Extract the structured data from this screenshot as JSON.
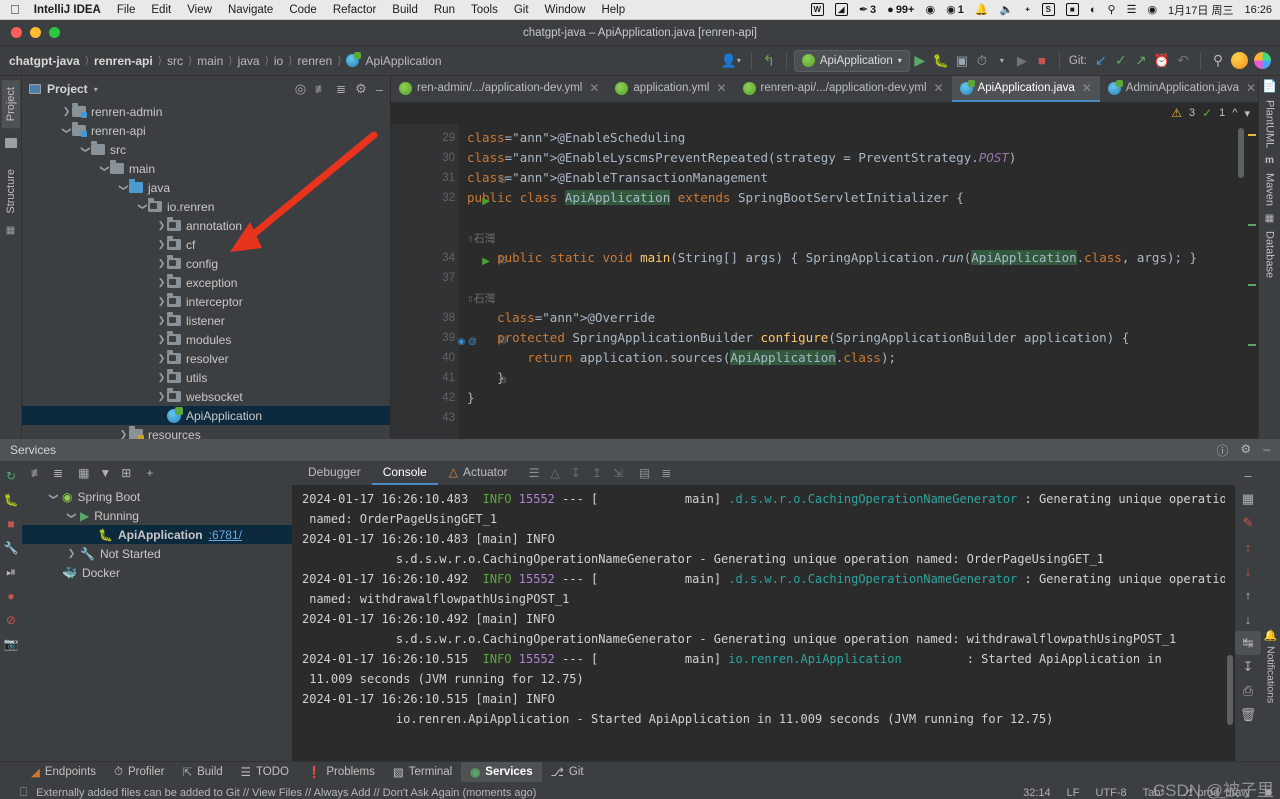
{
  "macbar": {
    "apple_icon": "apple-icon",
    "app_name": "IntelliJ IDEA",
    "menus": [
      "File",
      "Edit",
      "View",
      "Navigate",
      "Code",
      "Refactor",
      "Build",
      "Run",
      "Tools",
      "Git",
      "Window",
      "Help"
    ],
    "status_items": [
      {
        "icon": "wps-icon",
        "glyph": "W",
        "label": ""
      },
      {
        "icon": "notes-icon",
        "glyph": "◩",
        "label": ""
      },
      {
        "icon": "thunderbird-icon",
        "glyph": "✐",
        "label": "3"
      },
      {
        "icon": "bell-filled-icon",
        "glyph": "⬤",
        "label": "99+"
      },
      {
        "icon": "wechat-icon",
        "glyph": "◉",
        "label": ""
      },
      {
        "icon": "wechat-work-icon",
        "glyph": "◉",
        "label": "1"
      },
      {
        "icon": "notification-bell-icon",
        "glyph": "⬤",
        "label": ""
      },
      {
        "icon": "volume-icon",
        "glyph": "◂",
        "label": ""
      },
      {
        "icon": "bluetooth-icon",
        "glyph": "Ƀ",
        "label": ""
      },
      {
        "icon": "snipaste-icon",
        "glyph": "S",
        "label": ""
      },
      {
        "icon": "battery-icon",
        "glyph": "▮",
        "label": ""
      },
      {
        "icon": "wifi-icon",
        "glyph": "◠",
        "label": ""
      },
      {
        "icon": "spotlight-search-icon",
        "glyph": "⚲",
        "label": ""
      },
      {
        "icon": "control-center-icon",
        "glyph": "⌸",
        "label": ""
      },
      {
        "icon": "siri-icon",
        "glyph": "●",
        "label": ""
      }
    ],
    "date": "1月17日 周三",
    "time": "16:26"
  },
  "window": {
    "title": "chatgpt-java – ApiApplication.java [renren-api]"
  },
  "navbar": {
    "breadcrumbs": [
      "chatgpt-java",
      "renren-api",
      "src",
      "main",
      "java",
      "io",
      "renren",
      "ApiApplication"
    ],
    "run_config": "ApiApplication",
    "git_label": "Git:",
    "icons": [
      "vcs-person-icon",
      "back-arrow-icon",
      "run-icon",
      "debug-icon",
      "run-with-coverage-icon",
      "profiler-icon",
      "rerun-icon",
      "stop-icon",
      "update-project-icon",
      "commit-icon",
      "push-icon",
      "history-icon",
      "rollback-icon",
      "search-everywhere-icon",
      "account-avatar-icon",
      "ai-assistant-icon"
    ]
  },
  "left_strip": {
    "tabs": [
      {
        "label": "Project",
        "icon": "project-icon",
        "selected": true
      },
      {
        "label": "Structure",
        "icon": "structure-icon",
        "selected": false
      }
    ]
  },
  "right_strip": {
    "tabs": [
      {
        "label": "PlantUML",
        "icon": "plantuml-icon"
      },
      {
        "label": "Maven",
        "icon": "maven-icon"
      },
      {
        "label": "Database",
        "icon": "database-icon"
      }
    ]
  },
  "project_panel": {
    "title": "Project",
    "dropdown_icon": "chevron-down-icon",
    "toolbar_icons": [
      "select-opened-file-icon",
      "expand-all-icon",
      "collapse-all-icon",
      "settings-gear-icon",
      "hide-icon"
    ],
    "tree": [
      {
        "label": "renren-admin",
        "depth": 1,
        "arrow": "collapsed",
        "icon": "module-folder",
        "selected": false
      },
      {
        "label": "renren-api",
        "depth": 1,
        "arrow": "expanded",
        "icon": "module-folder",
        "selected": false
      },
      {
        "label": "src",
        "depth": 2,
        "arrow": "expanded",
        "icon": "folder-gray",
        "selected": false
      },
      {
        "label": "main",
        "depth": 3,
        "arrow": "expanded",
        "icon": "folder-gray",
        "selected": false
      },
      {
        "label": "java",
        "depth": 4,
        "arrow": "expanded",
        "icon": "folder-blue",
        "selected": false
      },
      {
        "label": "io.renren",
        "depth": 5,
        "arrow": "expanded",
        "icon": "package",
        "selected": false
      },
      {
        "label": "annotation",
        "depth": 6,
        "arrow": "collapsed",
        "icon": "package",
        "selected": false
      },
      {
        "label": "cf",
        "depth": 6,
        "arrow": "collapsed",
        "icon": "package",
        "selected": false
      },
      {
        "label": "config",
        "depth": 6,
        "arrow": "collapsed",
        "icon": "package",
        "selected": false
      },
      {
        "label": "exception",
        "depth": 6,
        "arrow": "collapsed",
        "icon": "package",
        "selected": false
      },
      {
        "label": "interceptor",
        "depth": 6,
        "arrow": "collapsed",
        "icon": "package",
        "selected": false
      },
      {
        "label": "listener",
        "depth": 6,
        "arrow": "collapsed",
        "icon": "package",
        "selected": false
      },
      {
        "label": "modules",
        "depth": 6,
        "arrow": "collapsed",
        "icon": "package",
        "selected": false
      },
      {
        "label": "resolver",
        "depth": 6,
        "arrow": "collapsed",
        "icon": "package",
        "selected": false
      },
      {
        "label": "utils",
        "depth": 6,
        "arrow": "collapsed",
        "icon": "package",
        "selected": false
      },
      {
        "label": "websocket",
        "depth": 6,
        "arrow": "collapsed",
        "icon": "package",
        "selected": false
      },
      {
        "label": "ApiApplication",
        "depth": 6,
        "arrow": "none",
        "icon": "spring-class",
        "selected": true
      },
      {
        "label": "resources",
        "depth": 4,
        "arrow": "collapsed",
        "icon": "resources-folder",
        "selected": false
      }
    ]
  },
  "editor": {
    "tabs": [
      {
        "label": "ren-admin/.../application-dev.yml",
        "icon": "spring-yaml-icon",
        "active": false,
        "closable": true
      },
      {
        "label": "application.yml",
        "icon": "spring-yaml-icon",
        "active": false,
        "closable": true
      },
      {
        "label": "renren-api/.../application-dev.yml",
        "icon": "spring-yaml-icon",
        "active": false,
        "closable": true
      },
      {
        "label": "ApiApplication.java",
        "icon": "spring-class-icon",
        "active": true,
        "closable": true
      },
      {
        "label": "AdminApplication.java",
        "icon": "spring-class-icon",
        "active": false,
        "closable": true
      }
    ],
    "tab_overflow_icons": [
      "chevron-down-icon",
      "more-vertical-icon"
    ],
    "inspection": {
      "warning_count": "3",
      "weak_warning_count": "1",
      "prev_icon": "chevron-up-icon",
      "next_icon": "chevron-down-icon"
    },
    "author_tag": "石灿",
    "lines": [
      {
        "num": "29",
        "code": "@EnableScheduling"
      },
      {
        "num": "30",
        "code": "@EnableLyscmsPreventRepeated(strategy = PreventStrategy.POST)"
      },
      {
        "num": "31",
        "code": "@EnableTransactionManagement"
      },
      {
        "num": "32",
        "code": "public class ApiApplication extends SpringBootServletInitializer {"
      },
      {
        "num": "",
        "code": ""
      },
      {
        "num": "",
        "code": "石灿"
      },
      {
        "num": "34",
        "code": "    public static void main(String[] args) { SpringApplication.run(ApiApplication.class, args); }"
      },
      {
        "num": "37",
        "code": ""
      },
      {
        "num": "",
        "code": "石灿"
      },
      {
        "num": "38",
        "code": "    @Override"
      },
      {
        "num": "39",
        "code": "    protected SpringApplicationBuilder configure(SpringApplicationBuilder application) {"
      },
      {
        "num": "40",
        "code": "        return application.sources(ApiApplication.class);"
      },
      {
        "num": "41",
        "code": "    }"
      },
      {
        "num": "42",
        "code": "}"
      },
      {
        "num": "43",
        "code": ""
      }
    ]
  },
  "services": {
    "title": "Services",
    "head_icons": [
      "help-icon",
      "settings-gear-icon",
      "hide-icon"
    ],
    "left_icons": [
      "rerun-icon",
      "debug-icon",
      "stop-icon",
      "settings-wrench-icon",
      "resume-icon",
      "mute-breakpoints-icon",
      "disable-breakpoints-icon",
      "camera-icon"
    ],
    "toolbar_icons": [
      "expand-all-icon",
      "collapse-all-icon",
      "group-icon",
      "filter-icon",
      "add-tab-icon",
      "add-service-icon"
    ],
    "tree": [
      {
        "label": "Spring Boot",
        "depth": 1,
        "arrow": "expanded",
        "icon": "spring-boot-icon",
        "selected": false,
        "link": ""
      },
      {
        "label": "Running",
        "depth": 2,
        "arrow": "expanded",
        "icon": "run-green-icon",
        "selected": false,
        "link": ""
      },
      {
        "label": "ApiApplication",
        "depth": 3,
        "arrow": "none",
        "icon": "debug-bug-icon",
        "selected": true,
        "link": ":6781/"
      },
      {
        "label": "Not Started",
        "depth": 2,
        "arrow": "collapsed",
        "icon": "wrench-icon",
        "selected": false,
        "link": ""
      },
      {
        "label": "Docker",
        "depth": 1,
        "arrow": "none",
        "icon": "docker-icon",
        "selected": false,
        "link": ""
      }
    ],
    "console_tabs": [
      {
        "label": "Debugger",
        "icon": "",
        "active": false
      },
      {
        "label": "Console",
        "icon": "",
        "active": true
      },
      {
        "label": "Actuator",
        "icon": "actuator-icon",
        "active": false
      }
    ],
    "console_tool_icons": [
      "soft-wrap-icon",
      "scroll-up-icon",
      "scroll-to-end-icon",
      "scroll-to-top-icon",
      "scroll-end-icon",
      "print-icon",
      "clear-icon"
    ],
    "right_icons": [
      "hide-icon",
      "layout-icon",
      "edit-red-icon",
      "up-red-icon",
      "down-red-icon",
      "up-icon",
      "down-icon",
      "soft-wrap-icon",
      "scroll-to-end-icon",
      "print-icon",
      "trash-icon"
    ],
    "notifications_label": "Notifications",
    "console_log": [
      {
        "ts": "2024-01-17 16:26:10.483",
        "level": "INFO",
        "pid": "15552",
        "thread": "main]",
        "cls": ".d.s.w.r.o.CachingOperationNameGenerator",
        "msg": ": Generating unique operation"
      },
      {
        "plain": " named: OrderPageUsingGET_1"
      },
      {
        "plain": "2024-01-17 16:26:10.483 [main] INFO"
      },
      {
        "plain": "             s.d.s.w.r.o.CachingOperationNameGenerator - Generating unique operation named: OrderPageUsingGET_1"
      },
      {
        "ts": "2024-01-17 16:26:10.492",
        "level": "INFO",
        "pid": "15552",
        "thread": "main]",
        "cls": ".d.s.w.r.o.CachingOperationNameGenerator",
        "msg": ": Generating unique operation"
      },
      {
        "plain": " named: withdrawalflowpathUsingPOST_1"
      },
      {
        "plain": "2024-01-17 16:26:10.492 [main] INFO"
      },
      {
        "plain": "             s.d.s.w.r.o.CachingOperationNameGenerator - Generating unique operation named: withdrawalflowpathUsingPOST_1"
      },
      {
        "ts": "2024-01-17 16:26:10.515",
        "level": "INFO",
        "pid": "15552",
        "thread": "main]",
        "cls": "io.renren.ApiApplication",
        "msg": "        : Started ApiApplication in"
      },
      {
        "plain": " 11.009 seconds (JVM running for 12.75)"
      },
      {
        "plain": "2024-01-17 16:26:10.515 [main] INFO"
      },
      {
        "plain": "             io.renren.ApiApplication - Started ApiApplication in 11.009 seconds (JVM running for 12.75)"
      }
    ]
  },
  "toolwindow_bar": {
    "items": [
      {
        "label": "Endpoints",
        "icon": "endpoints-icon",
        "active": false
      },
      {
        "label": "Profiler",
        "icon": "profiler-icon",
        "active": false
      },
      {
        "label": "Build",
        "icon": "build-hammer-icon",
        "active": false
      },
      {
        "label": "TODO",
        "icon": "todo-list-icon",
        "active": false
      },
      {
        "label": "Problems",
        "icon": "problems-icon",
        "active": false
      },
      {
        "label": "Terminal",
        "icon": "terminal-icon",
        "active": false
      },
      {
        "label": "Services",
        "icon": "services-icon",
        "active": true
      },
      {
        "label": "Git",
        "icon": "git-branch-icon",
        "active": false
      }
    ]
  },
  "statusbar": {
    "message_icon": "memory-indicator-icon",
    "message": "Externally added files can be added to Git // View Files // Always Add // Don't Ask Again (moments ago)",
    "caret": "32:14",
    "line_sep": "LF",
    "encoding": "UTF-8",
    "indent": "Tab*",
    "branch_icon": "git-branch-icon",
    "branch": "prod_draw",
    "lock_icon": "lock-icon"
  },
  "watermark": {
    "text": "CSDN @被子里"
  },
  "colors": {
    "accent_blue": "#4a88c7",
    "selection": "#0d293e",
    "panel_bg": "#3c3f41",
    "editor_bg": "#2b2b2b",
    "annotation_yellow": "#bbb529",
    "keyword_orange": "#cc7832",
    "method_yellow": "#ffc66d",
    "arrow_red": "#e8341c"
  }
}
